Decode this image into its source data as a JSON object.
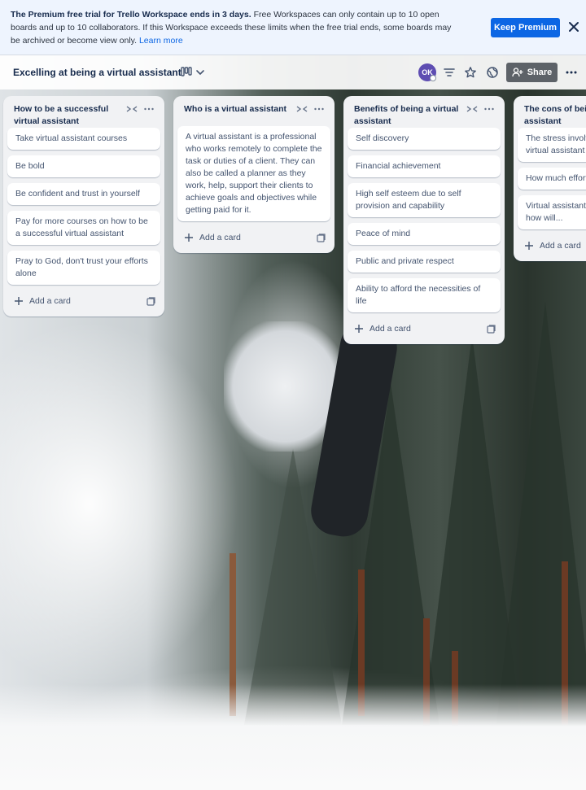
{
  "banner": {
    "bold_text": "The Premium free trial for Trello Workspace ends in 3 days.",
    "body_text": " Free Workspaces can only contain up to 10 open boards and up to 10 collaborators. If this Workspace exceeds these limits when the free trial ends, some boards may be archived or become view only. ",
    "link_text": "Learn more",
    "button_label": "Keep Premium",
    "close_icon": "close-icon"
  },
  "board": {
    "title": "Excelling at being a virtual assistant",
    "view_icon": "board-view-icon",
    "avatar_initials": "OK",
    "share_label": "Share",
    "icons": [
      "filter-icon",
      "star-icon",
      "visibility-icon",
      "share-icon",
      "more-icon"
    ]
  },
  "lists": [
    {
      "title": "How to be a successful virtual assistant",
      "cards": [
        "Take virtual assistant courses",
        "Be bold",
        "Be confident and trust in yourself",
        "Pay for more courses on how to be a successful virtual assistant",
        "Pray to God, don't trust your efforts alone"
      ],
      "add_label": "Add a card"
    },
    {
      "title": "Who is a virtual assistant",
      "cards": [
        "A virtual assistant is a professional who works remotely to complete the task or duties of a client. They can also be called a planner as they work, help, support their clients to achieve goals and objectives while getting paid for it."
      ],
      "add_label": "Add a card"
    },
    {
      "title": "Benefits of being a virtual assistant",
      "cards": [
        "Self discovery",
        "Financial achievement",
        "High self esteem due to self provision and capability",
        "Peace of mind",
        "Public and private respect",
        "Ability to afford the necessities of life"
      ],
      "add_label": "Add a card"
    },
    {
      "title": "The cons of being a virtual assistant",
      "cards": [
        "The stress involved in being a virtual assistant",
        "How much effort is required therein",
        "Virtual assistants are not respected, how will..."
      ],
      "add_label": "Add a card"
    }
  ]
}
